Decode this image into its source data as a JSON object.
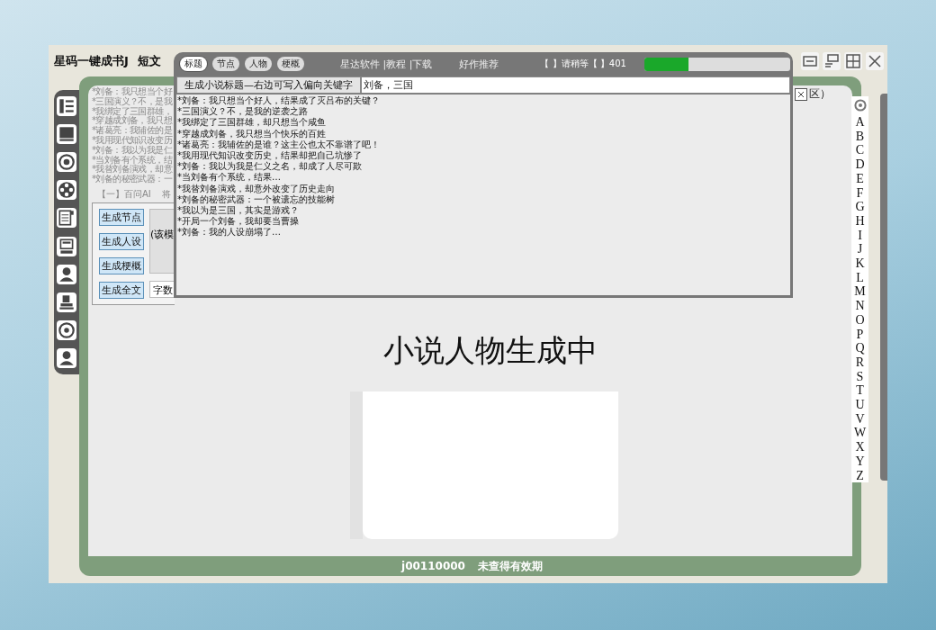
{
  "window": {
    "title": "星码一键成书J",
    "mode": "短文"
  },
  "background_list": [
    "*刘备：我只想当个好",
    "*三国演义？不，是我",
    "*我绑定了三国群雄，",
    "*穿越成刘备，我只想",
    "*诸葛亮：我辅佐的是",
    "*我用现代知识改变历",
    "*刘备：我以为我是仁",
    "*当刘备有个系统，结",
    "*我替刘备演戏，却意",
    "*刘备的秘密武器：一"
  ],
  "ask_row": {
    "ask_ai": "【一】百问AI",
    "column_2": "将"
  },
  "generate_buttons": [
    "生成节点",
    "生成人设",
    "生成梗概",
    "生成全文"
  ],
  "options_box": {
    "text": "(该模"
  },
  "word_count": {
    "label": "字数"
  },
  "right_note": {
    "checked": true,
    "text": "区）"
  },
  "heading": "小说人物生成中",
  "alphabet": [
    "A",
    "B",
    "C",
    "D",
    "E",
    "F",
    "G",
    "H",
    "I",
    "J",
    "K",
    "L",
    "M",
    "N",
    "O",
    "P",
    "Q",
    "R",
    "S",
    "T",
    "U",
    "V",
    "W",
    "X",
    "Y",
    "Z"
  ],
  "status_bar": {
    "account": "j00110000",
    "validity": "未查得有效期"
  },
  "popup": {
    "tabs": [
      {
        "label": "标题",
        "selected": true
      },
      {
        "label": "节点",
        "selected": false
      },
      {
        "label": "人物",
        "selected": false
      },
      {
        "label": "梗概",
        "selected": false
      }
    ],
    "links": [
      "星达软件 |教程 |下载",
      "好作推荐"
    ],
    "status": "【 】请稍等【 】401",
    "progress": {
      "level": 0.3
    },
    "generate_button": "生成小说标题—右边可写入偏向关键字",
    "keyword_field": {
      "value": "刘备，三国"
    },
    "results": [
      "*刘备：我只想当个好人，结果成了灭吕布的关键？",
      "*三国演义？不，是我的逆袭之路",
      "*我绑定了三国群雄，却只想当个咸鱼",
      "*穿越成刘备，我只想当个快乐的百姓",
      "*诸葛亮：我辅佐的是谁？这主公也太不靠谱了吧！",
      "*我用现代知识改变历史，结果却把自己坑惨了",
      "*刘备：我以为我是仁义之名，却成了人尽可欺",
      "*当刘备有个系统，结果…",
      "*我替刘备演戏，却意外改变了历史走向",
      "*刘备的秘密武器：一个被遗忘的技能树",
      "*我以为是三国，其实是游戏？",
      "*开局一个刘备，我却要当曹操",
      "*刘备：我的人设崩塌了…"
    ]
  }
}
